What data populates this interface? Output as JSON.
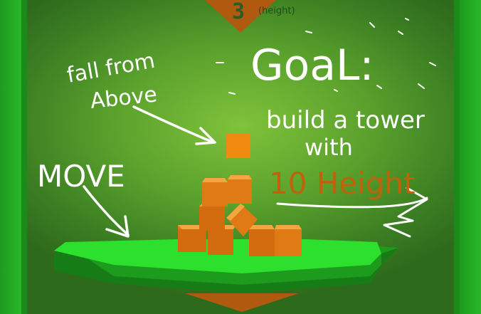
{
  "hud": {
    "height_value": "3",
    "height_label": "(height)"
  },
  "instructions": {
    "fall_line1": "fall from",
    "fall_line2": "Above",
    "goal_title": "GoaL:",
    "goal_line1": "build a tower",
    "goal_line2": "with",
    "goal_target": "10 Height",
    "move_label": "MOVE"
  },
  "colors": {
    "block": "#e07a14",
    "falling_block": "#f08a10",
    "platform_top": "#2ee02e",
    "platform_side": "#1d9b1d",
    "goal_target": "#c0620c",
    "marker": "#b05a10"
  }
}
